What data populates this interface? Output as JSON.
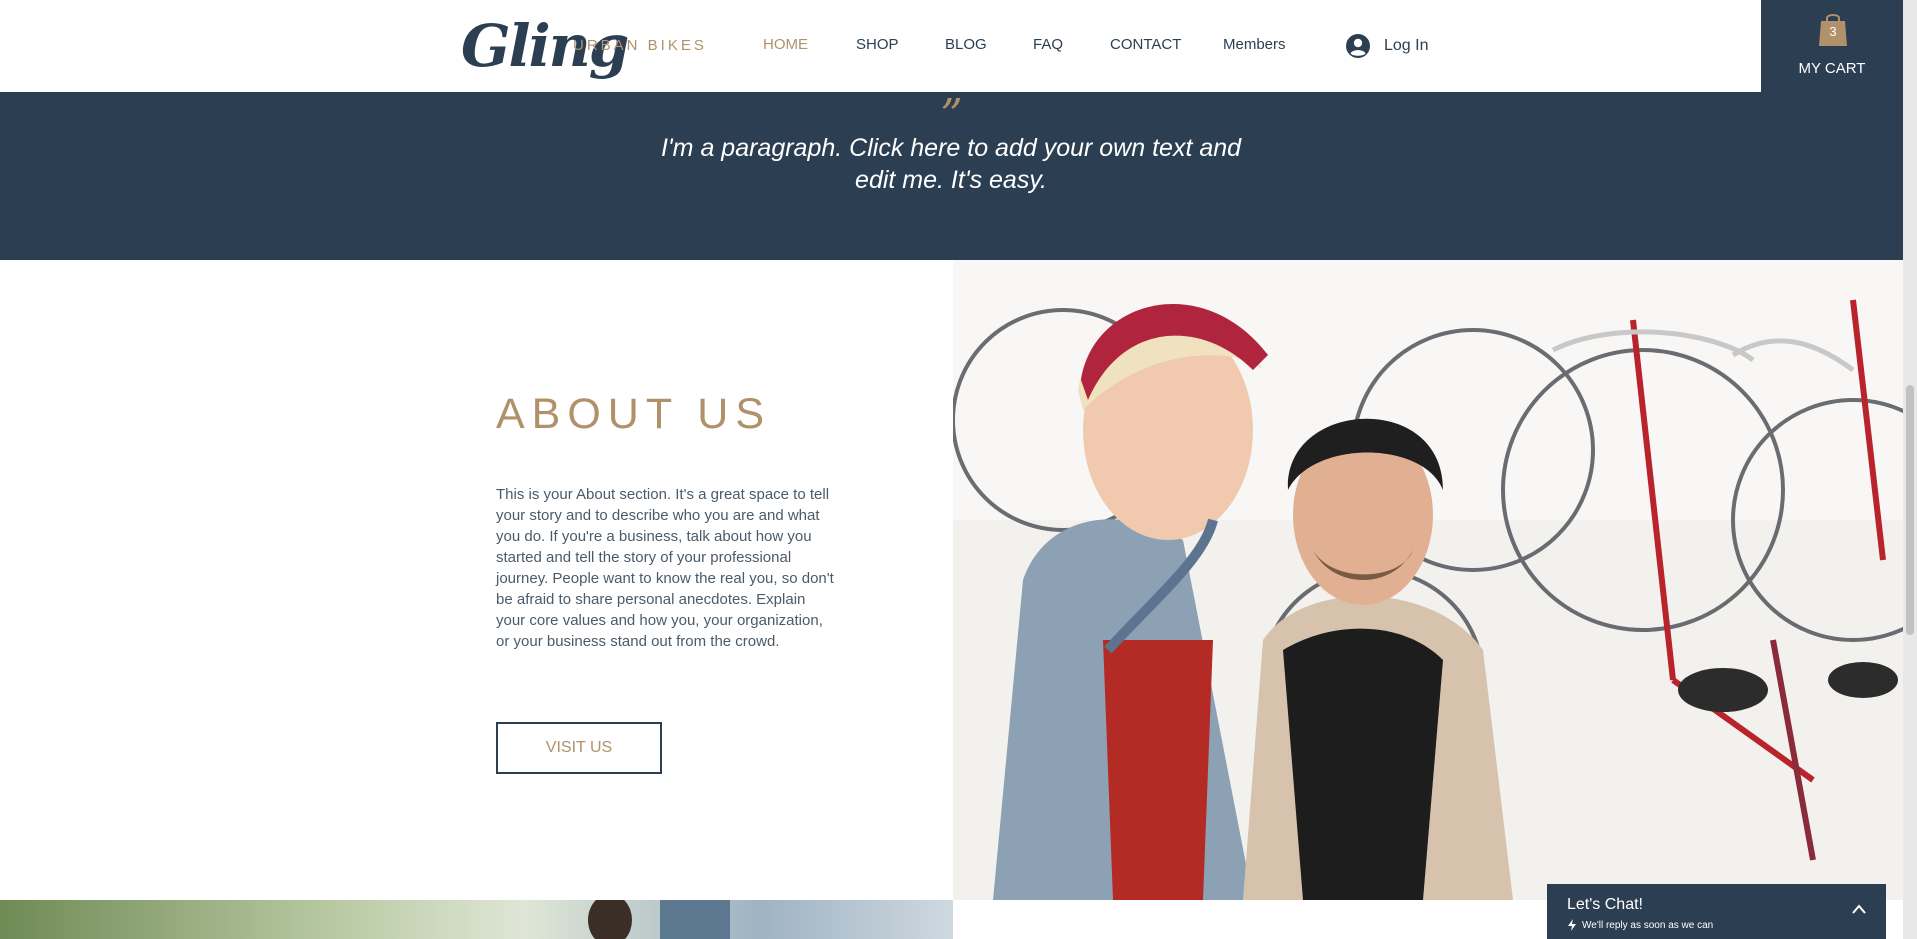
{
  "header": {
    "logo": "Gling",
    "tagline": "URBAN BIKES",
    "nav": [
      {
        "label": "HOME",
        "active": true
      },
      {
        "label": "SHOP",
        "active": false
      },
      {
        "label": "BLOG",
        "active": false
      },
      {
        "label": "FAQ",
        "active": false
      },
      {
        "label": "CONTACT",
        "active": false
      },
      {
        "label": "Members",
        "active": false
      }
    ],
    "login_label": "Log In",
    "login_icon": "user-avatar-icon"
  },
  "cart": {
    "count": "3",
    "label": "MY CART",
    "icon": "shopping-bag-icon"
  },
  "quote": {
    "mark": "”",
    "text": "I'm a paragraph. Click here to add your own text and edit me. It's easy."
  },
  "about": {
    "title": "ABOUT US",
    "body": "This is your About section. It's a great space to tell your story and to describe who you are and what you do. If you're a business, talk about how you started and tell the story of your professional journey. People want to know the real you, so don't be afraid to share personal anecdotes. Explain your core values and how you, your organization, or your business stand out from the crowd.",
    "button_label": "VISIT US"
  },
  "chat": {
    "title": "Let's Chat!",
    "subtitle": "We'll reply as soon as we can"
  },
  "colors": {
    "navy": "#2b3e52",
    "gold": "#b1916a",
    "body_text": "#4b5b69",
    "background": "#ffffff"
  }
}
